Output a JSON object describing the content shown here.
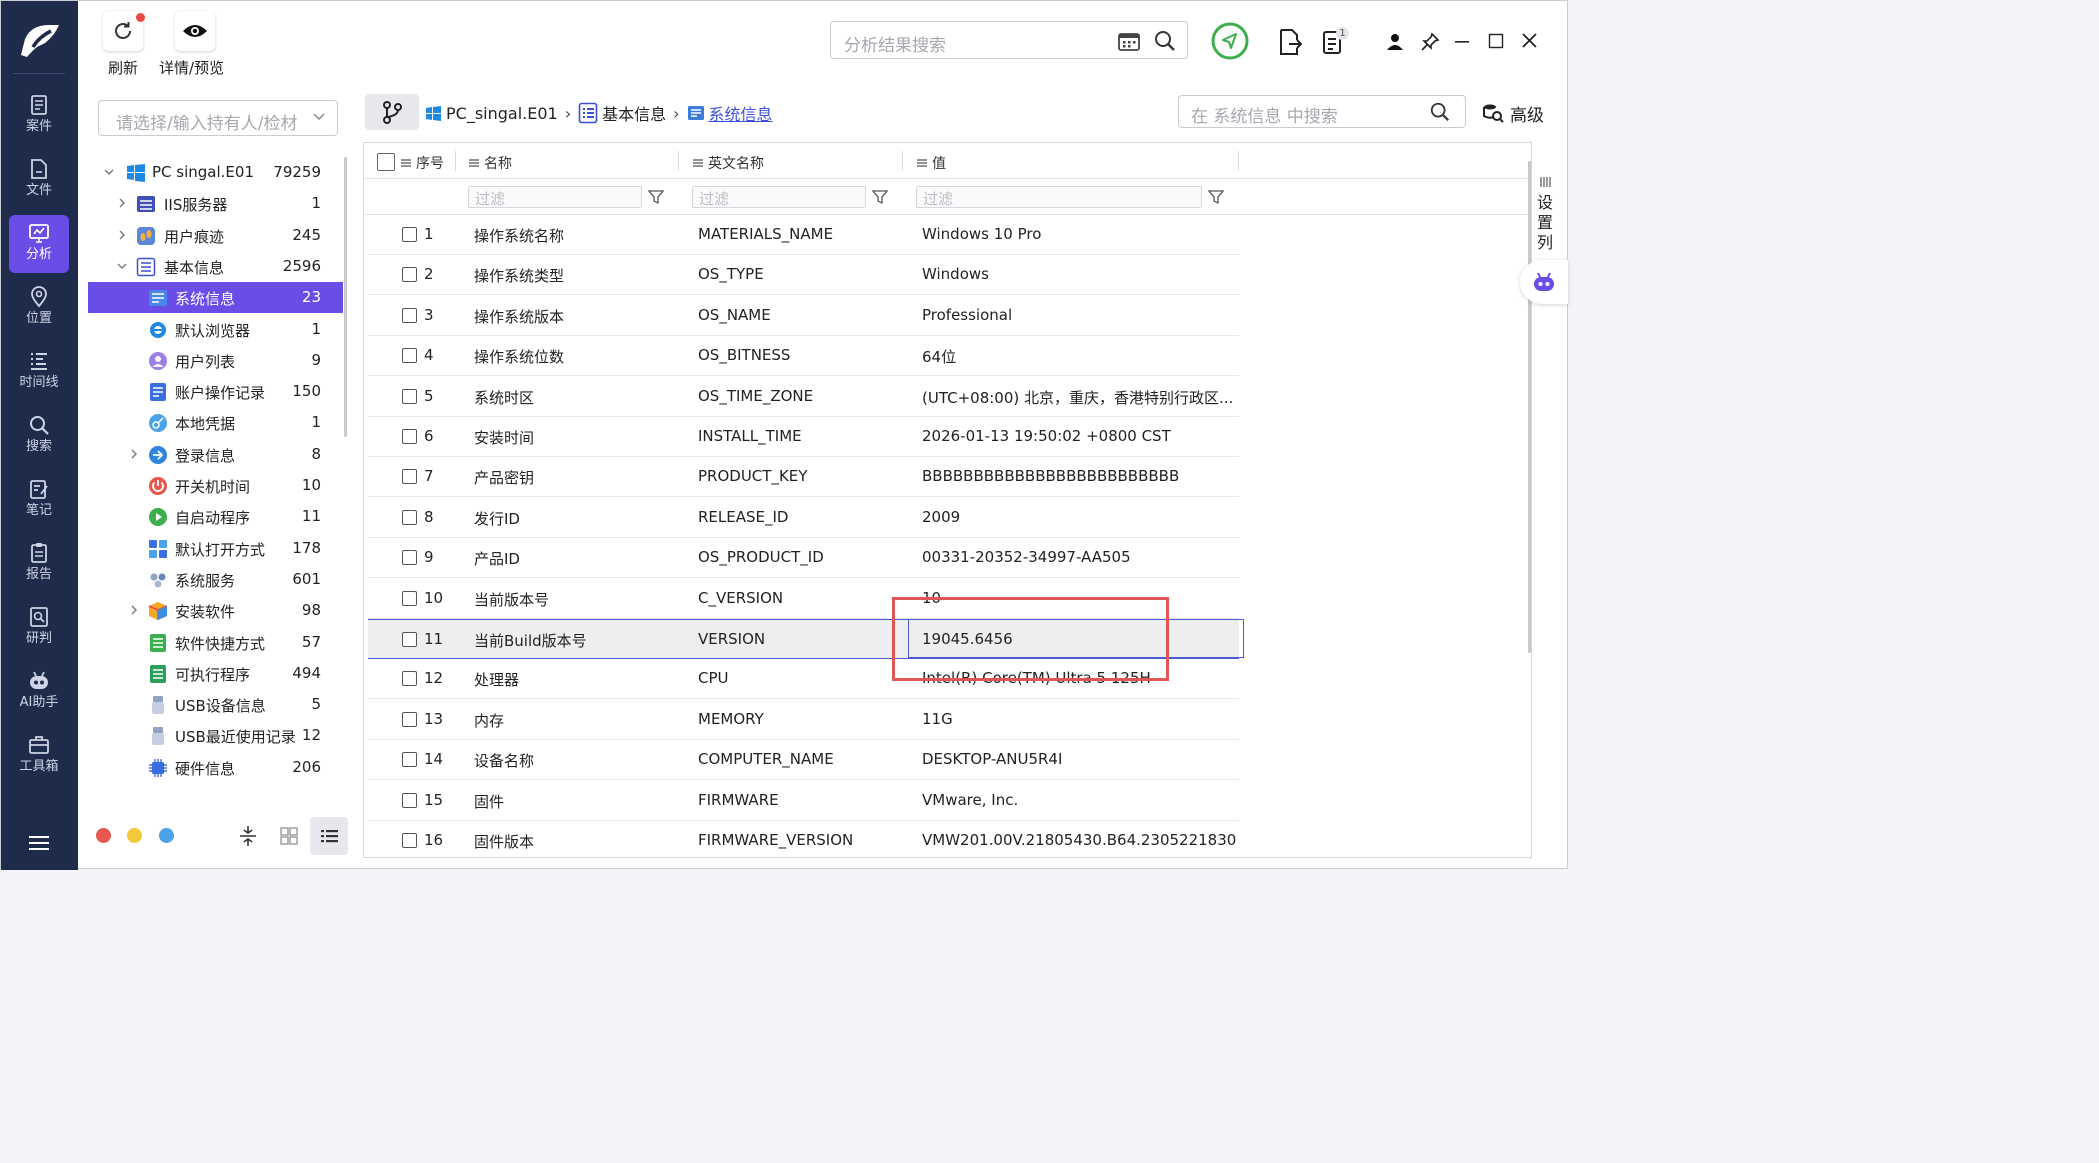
{
  "rail": {
    "items": [
      {
        "label": "案件",
        "icon": "case-icon"
      },
      {
        "label": "文件",
        "icon": "file-icon"
      },
      {
        "label": "分析",
        "icon": "analysis-icon"
      },
      {
        "label": "位置",
        "icon": "location-icon"
      },
      {
        "label": "时间线",
        "icon": "timeline-icon"
      },
      {
        "label": "搜索",
        "icon": "search-icon"
      },
      {
        "label": "笔记",
        "icon": "note-icon"
      },
      {
        "label": "报告",
        "icon": "report-icon"
      },
      {
        "label": "研判",
        "icon": "judge-icon"
      },
      {
        "label": "AI助手",
        "icon": "ai-assistant-icon"
      },
      {
        "label": "工具箱",
        "icon": "toolbox-icon"
      }
    ],
    "active_index": 2
  },
  "toolbar": {
    "refresh_label": "刷新",
    "preview_label": "详情/预览",
    "search_placeholder": "分析结果搜索",
    "notification_count": "1"
  },
  "tree": {
    "holder_placeholder": "请选择/输入持有人/检材",
    "rows": [
      {
        "label": "PC singal.E01",
        "count": "79259",
        "icon": "windows-icon",
        "expand": "open"
      },
      {
        "label": "IIS服务器",
        "count": "1",
        "icon": "server-icon",
        "expand": "closed"
      },
      {
        "label": "用户痕迹",
        "count": "245",
        "icon": "footprint-icon",
        "expand": "closed"
      },
      {
        "label": "基本信息",
        "count": "2596",
        "icon": "list-icon",
        "expand": "open"
      },
      {
        "label": "系统信息",
        "count": "23",
        "icon": "system-info-icon",
        "expand": "none"
      },
      {
        "label": "默认浏览器",
        "count": "1",
        "icon": "ie-browser-icon",
        "expand": "none"
      },
      {
        "label": "用户列表",
        "count": "9",
        "icon": "user-icon",
        "expand": "none"
      },
      {
        "label": "账户操作记录",
        "count": "150",
        "icon": "account-log-icon",
        "expand": "none"
      },
      {
        "label": "本地凭据",
        "count": "1",
        "icon": "key-icon",
        "expand": "none"
      },
      {
        "label": "登录信息",
        "count": "8",
        "icon": "login-icon",
        "expand": "closed"
      },
      {
        "label": "开关机时间",
        "count": "10",
        "icon": "power-icon",
        "expand": "none"
      },
      {
        "label": "自启动程序",
        "count": "11",
        "icon": "play-icon",
        "expand": "none"
      },
      {
        "label": "默认打开方式",
        "count": "178",
        "icon": "apps-icon",
        "expand": "none"
      },
      {
        "label": "系统服务",
        "count": "601",
        "icon": "service-icon",
        "expand": "none"
      },
      {
        "label": "安装软件",
        "count": "98",
        "icon": "package-icon",
        "expand": "closed"
      },
      {
        "label": "软件快捷方式",
        "count": "57",
        "icon": "shortcut-icon",
        "expand": "none"
      },
      {
        "label": "可执行程序",
        "count": "494",
        "icon": "executable-icon",
        "expand": "none"
      },
      {
        "label": "USB设备信息",
        "count": "5",
        "icon": "usb-icon",
        "expand": "none"
      },
      {
        "label": "USB最近使用记录",
        "count": "12",
        "icon": "usb-icon",
        "expand": "none"
      },
      {
        "label": "硬件信息",
        "count": "206",
        "icon": "chip-icon",
        "expand": "none"
      }
    ],
    "selected_index": 4,
    "dots": [
      "#e8564e",
      "#f3c93a",
      "#4aa3e8"
    ]
  },
  "breadcrumb": {
    "items": [
      "PC_singal.E01",
      "基本信息",
      "系统信息"
    ]
  },
  "content_search": {
    "placeholder": "在 系统信息 中搜索",
    "advanced_label": "高级"
  },
  "table": {
    "headers": {
      "no": "序号",
      "name": "名称",
      "en": "英文名称",
      "value": "值"
    },
    "filter_placeholder": "过滤",
    "rows": [
      {
        "no": "1",
        "name": "操作系统名称",
        "en": "MATERIALS_NAME",
        "value": "Windows 10 Pro"
      },
      {
        "no": "2",
        "name": "操作系统类型",
        "en": "OS_TYPE",
        "value": "Windows"
      },
      {
        "no": "3",
        "name": "操作系统版本",
        "en": "OS_NAME",
        "value": "Professional"
      },
      {
        "no": "4",
        "name": "操作系统位数",
        "en": "OS_BITNESS",
        "value": "64位"
      },
      {
        "no": "5",
        "name": "系统时区",
        "en": "OS_TIME_ZONE",
        "value": "(UTC+08:00) 北京，重庆，香港特别行政区..."
      },
      {
        "no": "6",
        "name": "安装时间",
        "en": "INSTALL_TIME",
        "value": "2026-01-13 19:50:02 +0800 CST"
      },
      {
        "no": "7",
        "name": "产品密钥",
        "en": "PRODUCT_KEY",
        "value": "BBBBBBBBBBBBBBBBBBBBBBBBB"
      },
      {
        "no": "8",
        "name": "发行ID",
        "en": "RELEASE_ID",
        "value": "2009"
      },
      {
        "no": "9",
        "name": "产品ID",
        "en": "OS_PRODUCT_ID",
        "value": "00331-20352-34997-AA505"
      },
      {
        "no": "10",
        "name": "当前版本号",
        "en": "C_VERSION",
        "value": "10"
      },
      {
        "no": "11",
        "name": "当前Build版本号",
        "en": "VERSION",
        "value": "19045.6456"
      },
      {
        "no": "12",
        "name": "处理器",
        "en": "CPU",
        "value": "Intel(R) Core(TM) Ultra 5 125H"
      },
      {
        "no": "13",
        "name": "内存",
        "en": "MEMORY",
        "value": "11G"
      },
      {
        "no": "14",
        "name": "设备名称",
        "en": "COMPUTER_NAME",
        "value": "DESKTOP-ANU5R4I"
      },
      {
        "no": "15",
        "name": "固件",
        "en": "FIRMWARE",
        "value": "VMware, Inc."
      },
      {
        "no": "16",
        "name": "固件版本",
        "en": "FIRMWARE_VERSION",
        "value": "VMW201.00V.21805430.B64.2305221830"
      }
    ],
    "selected_index": 10
  },
  "side": {
    "column_settings": [
      "设",
      "置",
      "列"
    ]
  },
  "colors": {
    "accent": "#6a4de6",
    "rail_bg": "#1f2b4b",
    "highlight": "#e25555",
    "link": "#3b4fd8"
  }
}
